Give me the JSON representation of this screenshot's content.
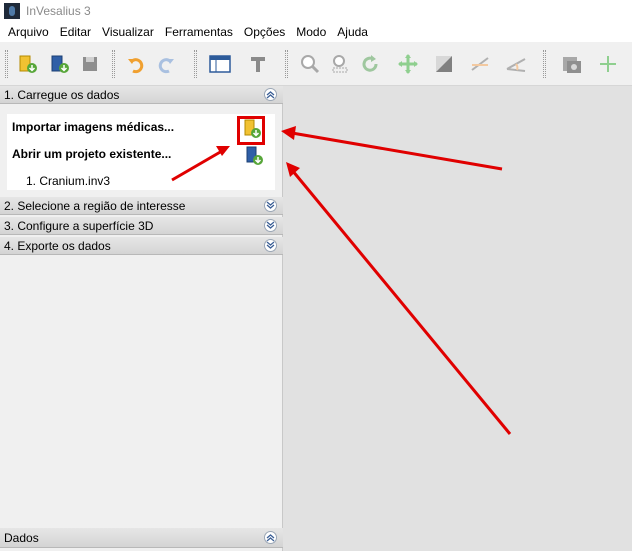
{
  "window": {
    "title": "InVesalius 3"
  },
  "menubar": [
    "Arquivo",
    "Editar",
    "Visualizar",
    "Ferramentas",
    "Opções",
    "Modo",
    "Ajuda"
  ],
  "toolbar": {
    "buttons": [
      "import-folder-icon",
      "open-project-icon",
      "save-project-icon",
      "undo-icon",
      "redo-icon",
      "layout-icon",
      "text-icon",
      "zoom-icon",
      "zoom-select-icon",
      "rotate-icon",
      "pan-icon",
      "contrast-icon",
      "measure-distance-icon",
      "measure-angle-icon",
      "snapshot-icon",
      "add-icon"
    ]
  },
  "left_panel": {
    "sections": [
      {
        "label": "1. Carregue os dados",
        "expanded": true
      },
      {
        "label": "2. Selecione a região de interesse",
        "expanded": false
      },
      {
        "label": "3. Configure a superfície 3D",
        "expanded": false
      },
      {
        "label": "4. Exporte os dados",
        "expanded": false
      }
    ],
    "load_data": {
      "import_label": "Importar imagens médicas...",
      "open_label": "Abrir um projeto existente...",
      "recent": [
        "1. Cranium.inv3"
      ]
    },
    "bottom_section": {
      "label": "Dados"
    }
  },
  "colors": {
    "annotation": "#e00000",
    "accent": "#3f6fb3"
  }
}
